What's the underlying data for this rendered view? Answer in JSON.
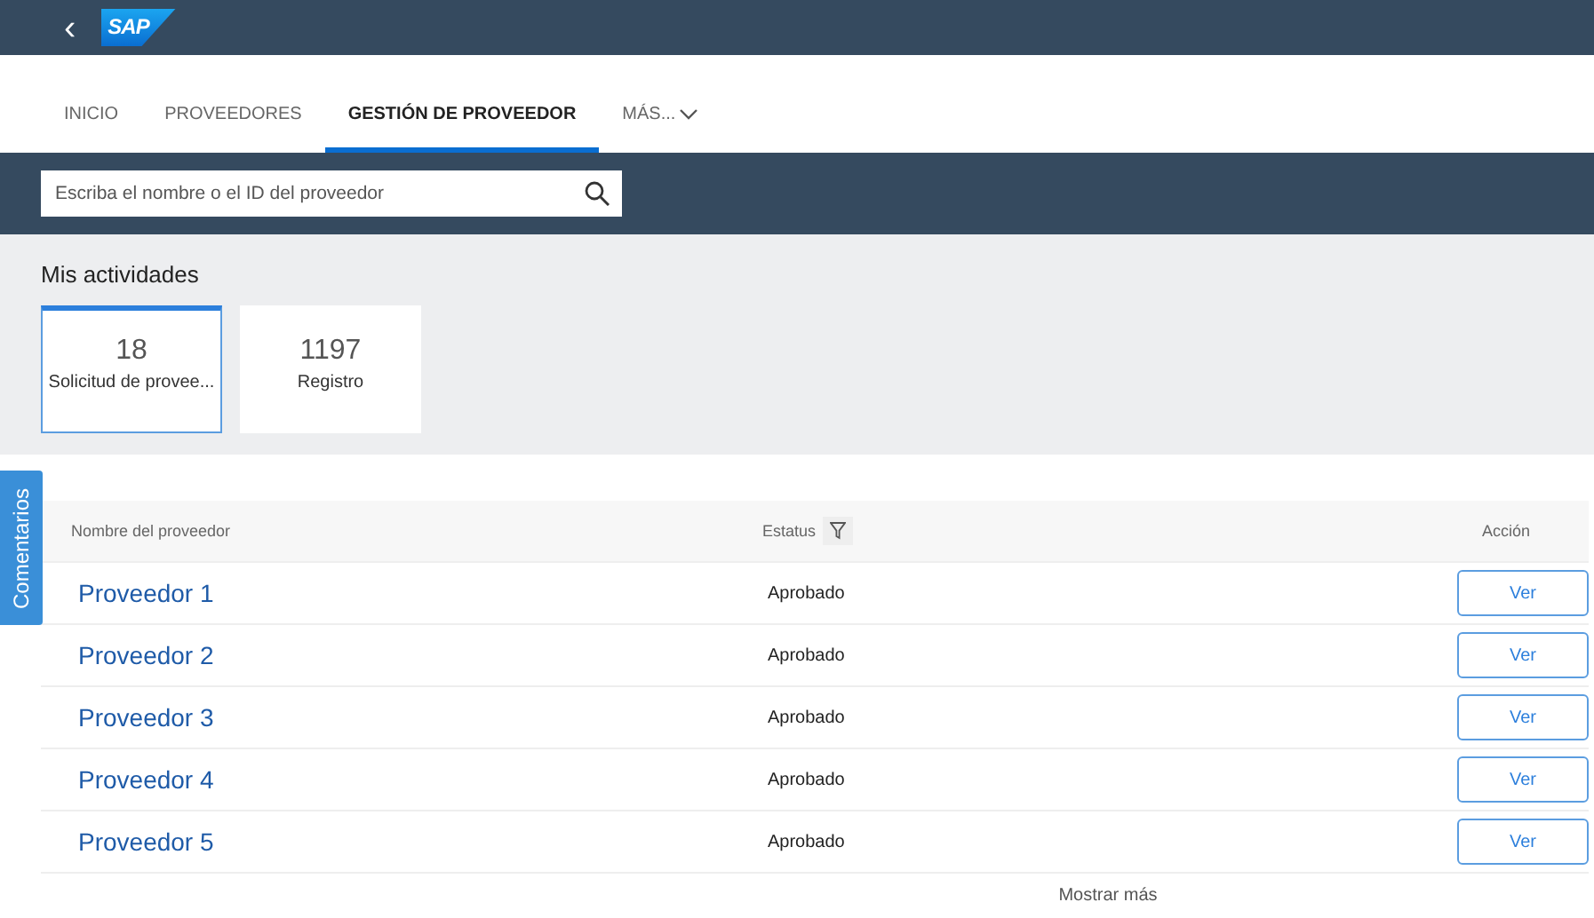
{
  "header": {
    "back": "‹",
    "logo": "SAP"
  },
  "tabs": [
    {
      "label": "INICIO",
      "selected": false
    },
    {
      "label": "PROVEEDORES",
      "selected": false
    },
    {
      "label": "GESTIÓN DE PROVEEDOR",
      "selected": true
    },
    {
      "label": "MÁS...",
      "selected": false,
      "kind": "more"
    }
  ],
  "search": {
    "placeholder": "Escriba el nombre o el ID del proveedor"
  },
  "activities": {
    "title": "Mis actividades",
    "tiles": [
      {
        "count": "18",
        "label": "Solicitud de provee...",
        "selected": true
      },
      {
        "count": "1197",
        "label": "Registro",
        "selected": false
      }
    ]
  },
  "feedback_tab": "Comentarios",
  "table": {
    "columns": [
      "Nombre del proveedor",
      "Estatus",
      "Acción"
    ],
    "rows": [
      {
        "name": "Proveedor 1",
        "status": "Aprobado",
        "action": "Ver"
      },
      {
        "name": "Proveedor 2",
        "status": "Aprobado",
        "action": "Ver"
      },
      {
        "name": "Proveedor 3",
        "status": "Aprobado",
        "action": "Ver"
      },
      {
        "name": "Proveedor 4",
        "status": "Aprobado",
        "action": "Ver"
      },
      {
        "name": "Proveedor 5",
        "status": "Aprobado",
        "action": "Ver"
      }
    ],
    "show_more": "Mostrar más"
  }
}
